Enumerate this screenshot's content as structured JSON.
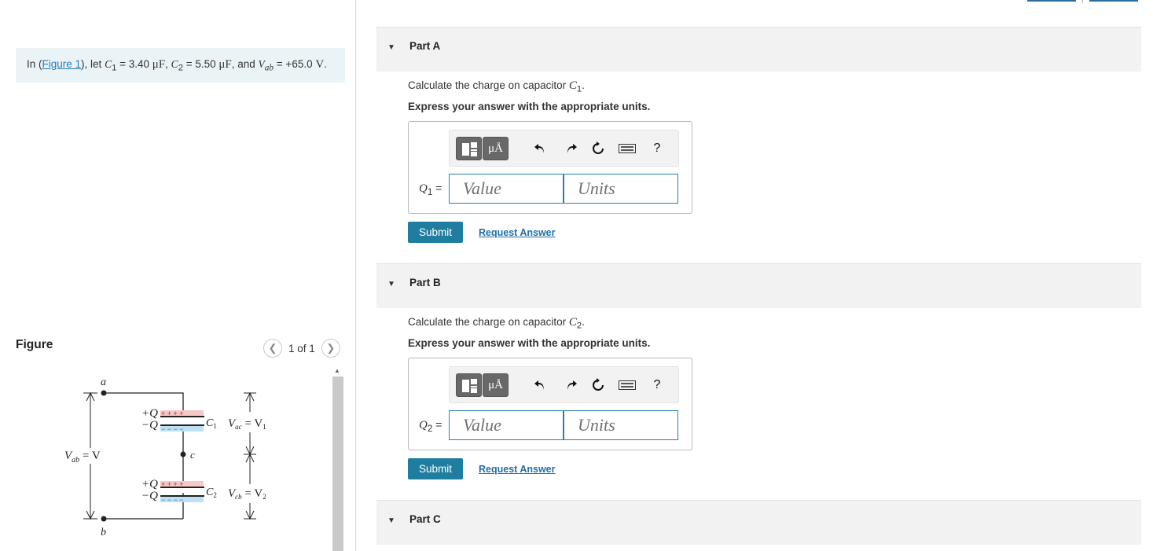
{
  "intro": {
    "prefix": "In (",
    "figure_link": "Figure 1",
    "suffix1": "), let ",
    "c1_sym": "C",
    "c1_sub": "1",
    "c1_eq": " = 3.40 ",
    "c1_unit": "μF",
    "sep1": ", ",
    "c2_sym": "C",
    "c2_sub": "2",
    "c2_eq": " = 5.50 ",
    "c2_unit": "μF",
    "sep2": ", and ",
    "v_sym": "V",
    "v_sub": "ab",
    "v_eq": " = +65.0 ",
    "v_unit": "V",
    "end": "."
  },
  "figure": {
    "title": "Figure",
    "pager_text": "1 of 1",
    "prev_icon": "chevron-left-icon",
    "next_icon": "chevron-right-icon",
    "labels": {
      "node_a": "a",
      "node_b": "b",
      "node_c": "c",
      "vab_left": "V",
      "vab_sub": "ab",
      "vab_right": " = V",
      "plus_q": "+Q",
      "minus_q": "−Q",
      "c1": "C",
      "c1_sub": "1",
      "c2": "C",
      "c2_sub": "2",
      "vac": "V",
      "vac_sub": "ac",
      "v1": " = V",
      "v1_sub": "1",
      "vcb": "V",
      "vcb_sub": "cb",
      "v2": " = V",
      "v2_sub": "2",
      "plus_marks": "+ + + +",
      "minus_marks": "− − − −"
    }
  },
  "parts": [
    {
      "label": "Part A",
      "question_prefix": "Calculate the charge on capacitor ",
      "cap_sym": "C",
      "cap_sub": "1",
      "question_suffix": ".",
      "express": "Express your answer with the appropriate units.",
      "answer_label_sym": "Q",
      "answer_label_sub": "1",
      "answer_label_eq": " =",
      "value_placeholder": "Value",
      "units_placeholder": "Units",
      "submit": "Submit",
      "request": "Request Answer"
    },
    {
      "label": "Part B",
      "question_prefix": "Calculate the charge on capacitor ",
      "cap_sym": "C",
      "cap_sub": "2",
      "question_suffix": ".",
      "express": "Express your answer with the appropriate units.",
      "answer_label_sym": "Q",
      "answer_label_sub": "2",
      "answer_label_eq": " =",
      "value_placeholder": "Value",
      "units_placeholder": "Units",
      "submit": "Submit",
      "request": "Request Answer"
    },
    {
      "label": "Part C"
    }
  ],
  "toolbar": {
    "templates_icon": "templates-icon",
    "units_button": "μÅ",
    "undo_icon": "undo-icon",
    "redo_icon": "redo-icon",
    "reset_icon": "reset-icon",
    "keyboard_icon": "keyboard-icon",
    "help": "?"
  },
  "colors": {
    "accent": "#1f7ea0",
    "link": "#1f6fa6",
    "intro_bg": "#eaf4f6",
    "part_bg": "#f2f2f2",
    "field_border": "#2a7fa6"
  }
}
